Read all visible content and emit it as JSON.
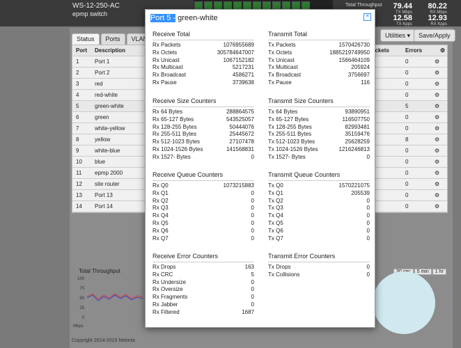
{
  "header": {
    "device_name": "WS-12-250-AC",
    "device_sub": "epmp switch",
    "throughput_label": "Total Throughput",
    "stats": [
      {
        "big": "79.44",
        "small": "TX Mbps"
      },
      {
        "big": "80.22",
        "small": "RX Mbps"
      },
      {
        "big": "12.58",
        "small": "TX Kpps"
      },
      {
        "big": "12.93",
        "small": "RX Kpps"
      }
    ]
  },
  "tabs": [
    "Status",
    "Ports",
    "VLANs"
  ],
  "buttons": {
    "utilities": "Utilities ▾",
    "save": "Save/Apply"
  },
  "table": {
    "headers": {
      "port": "Port",
      "desc": "Description",
      "packets": "ackets",
      "errors": "Errors"
    },
    "rows": [
      {
        "port": "1",
        "desc": "Port 1",
        "errors": "0"
      },
      {
        "port": "2",
        "desc": "Port 2",
        "errors": "0"
      },
      {
        "port": "3",
        "desc": "red",
        "errors": "0"
      },
      {
        "port": "4",
        "desc": "red-white",
        "errors": "0"
      },
      {
        "port": "5",
        "desc": "green-white",
        "errors": "5"
      },
      {
        "port": "6",
        "desc": "green",
        "errors": "0"
      },
      {
        "port": "7",
        "desc": "white-yellow",
        "errors": "0"
      },
      {
        "port": "8",
        "desc": "yellow",
        "errors": "8"
      },
      {
        "port": "9",
        "desc": "white-blue",
        "errors": "0"
      },
      {
        "port": "10",
        "desc": "blue",
        "errors": "0"
      },
      {
        "port": "11",
        "desc": "epmp 2000",
        "errors": "0"
      },
      {
        "port": "12",
        "desc": "site router",
        "errors": "0"
      },
      {
        "port": "13",
        "desc": "Port 13",
        "errors": "0"
      },
      {
        "port": "14",
        "desc": "Port 14",
        "errors": "0"
      }
    ]
  },
  "chart": {
    "title": "Total Throughput",
    "ylabel": "Mbps",
    "yticks": [
      "100",
      "75",
      "50",
      "25",
      "0"
    ]
  },
  "range_buttons": [
    "30 sec",
    "5 min",
    "1 hr"
  ],
  "copyright": "Copyright 2014-2015 Netonix",
  "modal": {
    "title_highlight": "Port 5 -",
    "title_rest": " green-white",
    "sections": {
      "rx_total": {
        "title": "Receive Total",
        "rows": [
          {
            "k": "Rx Packets",
            "v": "1076955689"
          },
          {
            "k": "Rx Octets",
            "v": "305784647007"
          },
          {
            "k": "Rx Unicast",
            "v": "1067152182"
          },
          {
            "k": "Rx Multicast",
            "v": "5217231"
          },
          {
            "k": "Rx Broadcast",
            "v": "4586271"
          },
          {
            "k": "Rx Pause",
            "v": "3739638"
          }
        ]
      },
      "tx_total": {
        "title": "Transmit Total",
        "rows": [
          {
            "k": "Tx Packets",
            "v": "1570426730"
          },
          {
            "k": "Tx Octets",
            "v": "1885219749950"
          },
          {
            "k": "Tx Unicast",
            "v": "1566464109"
          },
          {
            "k": "Tx Multicast",
            "v": "205924"
          },
          {
            "k": "Tx Broadcast",
            "v": "3756697"
          },
          {
            "k": "Tx Pause",
            "v": "116"
          }
        ]
      },
      "rx_size": {
        "title": "Receive Size Counters",
        "rows": [
          {
            "k": "Rx 64 Bytes",
            "v": "288864575"
          },
          {
            "k": "Rx 65-127 Bytes",
            "v": "543525057"
          },
          {
            "k": "Rx 128-255 Bytes",
            "v": "50444076"
          },
          {
            "k": "Rx 255-511 Bytes",
            "v": "25445672"
          },
          {
            "k": "Rx 512-1023 Bytes",
            "v": "27107478"
          },
          {
            "k": "Rx 1024-1526 Bytes",
            "v": "141568831"
          },
          {
            "k": "Rx 1527- Bytes",
            "v": "0"
          }
        ]
      },
      "tx_size": {
        "title": "Transmit Size Counters",
        "rows": [
          {
            "k": "Tx 64 Bytes",
            "v": "93890951"
          },
          {
            "k": "Tx 65-127 Bytes",
            "v": "116507750"
          },
          {
            "k": "Tx 128-255 Bytes",
            "v": "82993481"
          },
          {
            "k": "Tx 255-511 Bytes",
            "v": "35159476"
          },
          {
            "k": "Tx 512-1023 Bytes",
            "v": "25628259"
          },
          {
            "k": "Tx 1024-1526 Bytes",
            "v": "1216246813"
          },
          {
            "k": "Tx 1527- Bytes",
            "v": "0"
          }
        ]
      },
      "rx_queue": {
        "title": "Receive Queue Counters",
        "rows": [
          {
            "k": "Rx Q0",
            "v": "1073215883"
          },
          {
            "k": "Rx Q1",
            "v": "0"
          },
          {
            "k": "Rx Q2",
            "v": "0"
          },
          {
            "k": "Rx Q3",
            "v": "0"
          },
          {
            "k": "Rx Q4",
            "v": "0"
          },
          {
            "k": "Rx Q5",
            "v": "0"
          },
          {
            "k": "Rx Q6",
            "v": "0"
          },
          {
            "k": "Rx Q7",
            "v": "0"
          }
        ]
      },
      "tx_queue": {
        "title": "Transmit Queue Counters",
        "rows": [
          {
            "k": "Tx Q0",
            "v": "1570221075"
          },
          {
            "k": "Tx Q1",
            "v": "205539"
          },
          {
            "k": "Tx Q2",
            "v": "0"
          },
          {
            "k": "Tx Q3",
            "v": "0"
          },
          {
            "k": "Tx Q4",
            "v": "0"
          },
          {
            "k": "Tx Q5",
            "v": "0"
          },
          {
            "k": "Tx Q6",
            "v": "0"
          },
          {
            "k": "Tx Q7",
            "v": "0"
          }
        ]
      },
      "rx_error": {
        "title": "Receive Error Counters",
        "rows": [
          {
            "k": "Rx Drops",
            "v": "163"
          },
          {
            "k": "Rx CRC",
            "v": "5"
          },
          {
            "k": "Rx Undersize",
            "v": "0"
          },
          {
            "k": "Rx Oversize",
            "v": "0"
          },
          {
            "k": "Rx Fragments",
            "v": "0"
          },
          {
            "k": "Rx Jabber",
            "v": "0"
          },
          {
            "k": "Rx Filtered",
            "v": "1687"
          }
        ]
      },
      "tx_error": {
        "title": "Transmit Error Counters",
        "rows": [
          {
            "k": "Tx Drops",
            "v": "0"
          },
          {
            "k": "Tx Collisions",
            "v": "0"
          }
        ]
      }
    }
  }
}
